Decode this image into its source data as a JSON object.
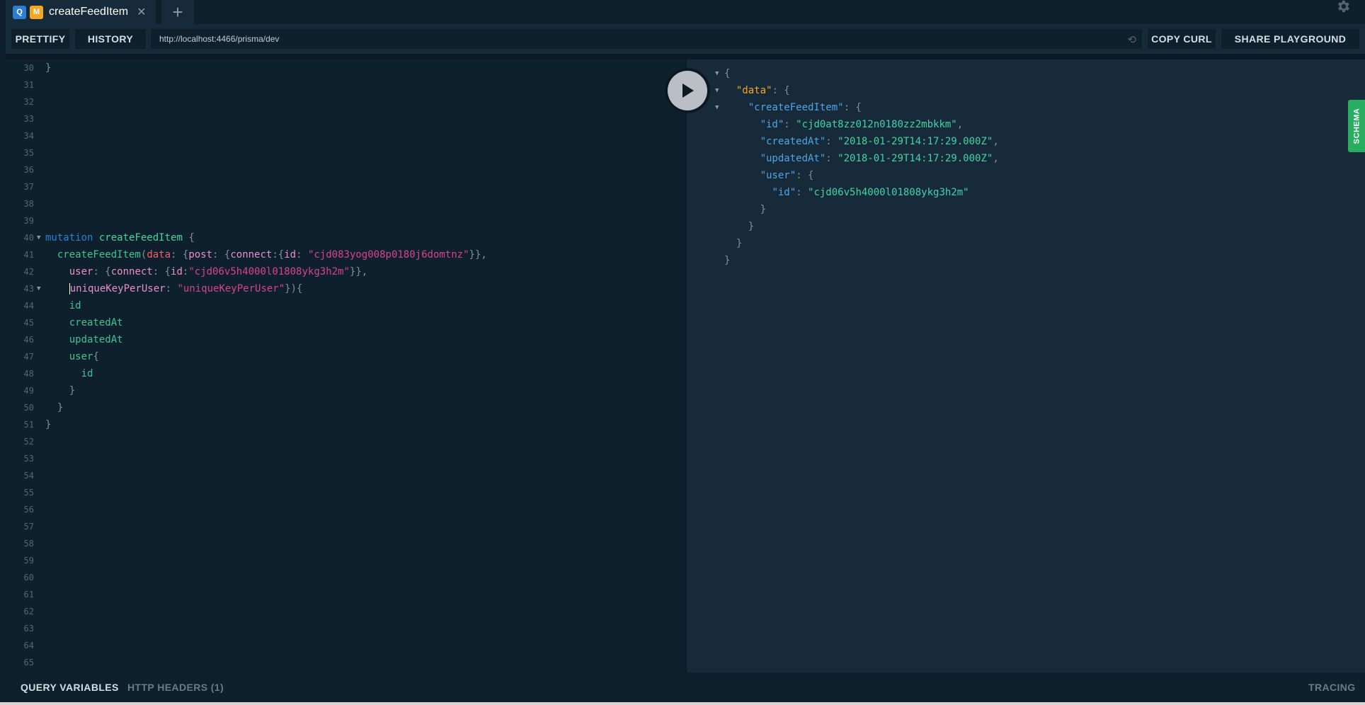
{
  "tabs": [
    {
      "query_badge": "Q",
      "mutation_badge": "M",
      "title": "createFeedItem",
      "close": "✕"
    }
  ],
  "add_tab": "+",
  "toolbar": {
    "prettify": "PRETTIFY",
    "history": "HISTORY",
    "url": "http://localhost:4466/prisma/dev",
    "copy_curl": "COPY CURL",
    "share": "SHARE PLAYGROUND"
  },
  "editor": {
    "lines": [
      {
        "n": "30",
        "fold": false,
        "tokens": [
          {
            "c": "t-p",
            "t": "}"
          }
        ]
      },
      {
        "n": "31",
        "fold": false,
        "tokens": []
      },
      {
        "n": "32",
        "fold": false,
        "tokens": []
      },
      {
        "n": "33",
        "fold": false,
        "tokens": []
      },
      {
        "n": "34",
        "fold": false,
        "tokens": []
      },
      {
        "n": "35",
        "fold": false,
        "tokens": []
      },
      {
        "n": "36",
        "fold": false,
        "tokens": []
      },
      {
        "n": "37",
        "fold": false,
        "tokens": []
      },
      {
        "n": "38",
        "fold": false,
        "tokens": []
      },
      {
        "n": "39",
        "fold": false,
        "tokens": []
      },
      {
        "n": "40",
        "fold": true,
        "tokens": [
          {
            "c": "t-kw",
            "t": "mutation"
          },
          {
            "c": "t-p",
            "t": " "
          },
          {
            "c": "t-def",
            "t": "createFeedItem"
          },
          {
            "c": "t-p",
            "t": " {"
          }
        ]
      },
      {
        "n": "41",
        "fold": false,
        "tokens": [
          {
            "c": "t-p",
            "t": "  "
          },
          {
            "c": "t-field",
            "t": "createFeedItem"
          },
          {
            "c": "t-p",
            "t": "("
          },
          {
            "c": "t-argd",
            "t": "data"
          },
          {
            "c": "t-p",
            "t": ": {"
          },
          {
            "c": "t-arg",
            "t": "post"
          },
          {
            "c": "t-p",
            "t": ": {"
          },
          {
            "c": "t-arg",
            "t": "connect"
          },
          {
            "c": "t-p",
            "t": ":{"
          },
          {
            "c": "t-arg",
            "t": "id"
          },
          {
            "c": "t-p",
            "t": ": "
          },
          {
            "c": "t-str",
            "t": "\"cjd083yog008p0180j6domtnz\""
          },
          {
            "c": "t-p",
            "t": "}},"
          }
        ]
      },
      {
        "n": "42",
        "fold": false,
        "tokens": [
          {
            "c": "t-p",
            "t": "    "
          },
          {
            "c": "t-arg",
            "t": "user"
          },
          {
            "c": "t-p",
            "t": ": {"
          },
          {
            "c": "t-arg",
            "t": "connect"
          },
          {
            "c": "t-p",
            "t": ": {"
          },
          {
            "c": "t-arg",
            "t": "id"
          },
          {
            "c": "t-p",
            "t": ":"
          },
          {
            "c": "t-str",
            "t": "\"cjd06v5h4000l01808ykg3h2m\""
          },
          {
            "c": "t-p",
            "t": "}},"
          }
        ]
      },
      {
        "n": "43",
        "fold": true,
        "cursor": true,
        "tokens": [
          {
            "c": "t-p",
            "t": "    "
          },
          {
            "c": "t-arg",
            "t": "uniqueKeyPerUser"
          },
          {
            "c": "t-p",
            "t": ": "
          },
          {
            "c": "t-str",
            "t": "\"uniqueKeyPerUser\""
          },
          {
            "c": "t-p",
            "t": "}){"
          }
        ]
      },
      {
        "n": "44",
        "fold": false,
        "tokens": [
          {
            "c": "t-p",
            "t": "    "
          },
          {
            "c": "t-field",
            "t": "id"
          }
        ]
      },
      {
        "n": "45",
        "fold": false,
        "tokens": [
          {
            "c": "t-p",
            "t": "    "
          },
          {
            "c": "t-field",
            "t": "createdAt"
          }
        ]
      },
      {
        "n": "46",
        "fold": false,
        "tokens": [
          {
            "c": "t-p",
            "t": "    "
          },
          {
            "c": "t-field",
            "t": "updatedAt"
          }
        ]
      },
      {
        "n": "47",
        "fold": false,
        "tokens": [
          {
            "c": "t-p",
            "t": "    "
          },
          {
            "c": "t-field",
            "t": "user"
          },
          {
            "c": "t-p",
            "t": "{"
          }
        ]
      },
      {
        "n": "48",
        "fold": false,
        "tokens": [
          {
            "c": "t-p",
            "t": "      "
          },
          {
            "c": "t-field",
            "t": "id"
          }
        ]
      },
      {
        "n": "49",
        "fold": false,
        "tokens": [
          {
            "c": "t-p",
            "t": "    }"
          }
        ]
      },
      {
        "n": "50",
        "fold": false,
        "tokens": [
          {
            "c": "t-p",
            "t": "  }"
          }
        ]
      },
      {
        "n": "51",
        "fold": false,
        "tokens": [
          {
            "c": "t-p",
            "t": "}"
          }
        ]
      },
      {
        "n": "52",
        "fold": false,
        "tokens": []
      },
      {
        "n": "53",
        "fold": false,
        "tokens": []
      },
      {
        "n": "54",
        "fold": false,
        "tokens": []
      },
      {
        "n": "55",
        "fold": false,
        "tokens": []
      },
      {
        "n": "56",
        "fold": false,
        "tokens": []
      },
      {
        "n": "57",
        "fold": false,
        "tokens": []
      },
      {
        "n": "58",
        "fold": false,
        "tokens": []
      },
      {
        "n": "59",
        "fold": false,
        "tokens": []
      },
      {
        "n": "60",
        "fold": false,
        "tokens": []
      },
      {
        "n": "61",
        "fold": false,
        "tokens": []
      },
      {
        "n": "62",
        "fold": false,
        "tokens": []
      },
      {
        "n": "63",
        "fold": false,
        "tokens": []
      },
      {
        "n": "64",
        "fold": false,
        "tokens": []
      },
      {
        "n": "65",
        "fold": false,
        "tokens": []
      }
    ]
  },
  "result": {
    "lines": [
      {
        "fold": true,
        "tokens": [
          {
            "c": "j-p",
            "t": "{"
          }
        ]
      },
      {
        "fold": true,
        "tokens": [
          {
            "c": "j-p",
            "t": "  "
          },
          {
            "c": "j-key-data",
            "t": "\"data\""
          },
          {
            "c": "j-p",
            "t": ": {"
          }
        ]
      },
      {
        "fold": true,
        "tokens": [
          {
            "c": "j-p",
            "t": "    "
          },
          {
            "c": "j-key",
            "t": "\"createFeedItem\""
          },
          {
            "c": "j-p",
            "t": ": {"
          }
        ]
      },
      {
        "fold": false,
        "tokens": [
          {
            "c": "j-p",
            "t": "      "
          },
          {
            "c": "j-key",
            "t": "\"id\""
          },
          {
            "c": "j-p",
            "t": ": "
          },
          {
            "c": "j-str",
            "t": "\"cjd0at8zz012n0180zz2mbkkm\""
          },
          {
            "c": "j-p",
            "t": ","
          }
        ]
      },
      {
        "fold": false,
        "tokens": [
          {
            "c": "j-p",
            "t": "      "
          },
          {
            "c": "j-key",
            "t": "\"createdAt\""
          },
          {
            "c": "j-p",
            "t": ": "
          },
          {
            "c": "j-str",
            "t": "\"2018-01-29T14:17:29.000Z\""
          },
          {
            "c": "j-p",
            "t": ","
          }
        ]
      },
      {
        "fold": false,
        "tokens": [
          {
            "c": "j-p",
            "t": "      "
          },
          {
            "c": "j-key",
            "t": "\"updatedAt\""
          },
          {
            "c": "j-p",
            "t": ": "
          },
          {
            "c": "j-str",
            "t": "\"2018-01-29T14:17:29.000Z\""
          },
          {
            "c": "j-p",
            "t": ","
          }
        ]
      },
      {
        "fold": false,
        "tokens": [
          {
            "c": "j-p",
            "t": "      "
          },
          {
            "c": "j-key",
            "t": "\"user\""
          },
          {
            "c": "j-p",
            "t": ": {"
          }
        ]
      },
      {
        "fold": false,
        "tokens": [
          {
            "c": "j-p",
            "t": "        "
          },
          {
            "c": "j-key",
            "t": "\"id\""
          },
          {
            "c": "j-p",
            "t": ": "
          },
          {
            "c": "j-str",
            "t": "\"cjd06v5h4000l01808ykg3h2m\""
          }
        ]
      },
      {
        "fold": false,
        "tokens": [
          {
            "c": "j-p",
            "t": "      }"
          }
        ]
      },
      {
        "fold": false,
        "tokens": [
          {
            "c": "j-p",
            "t": "    }"
          }
        ]
      },
      {
        "fold": false,
        "tokens": [
          {
            "c": "j-p",
            "t": "  }"
          }
        ]
      },
      {
        "fold": false,
        "tokens": [
          {
            "c": "j-p",
            "t": "}"
          }
        ]
      }
    ]
  },
  "schema_label": "SCHEMA",
  "bottom": {
    "query_variables": "QUERY VARIABLES",
    "http_headers": "HTTP HEADERS (1)",
    "tracing": "TRACING"
  },
  "icons": {
    "gear": "gear-icon",
    "play": "play-icon",
    "reload": "reload-icon"
  },
  "colors": {
    "accent_green": "#27ae60",
    "query_badge": "#2a7ed3",
    "mutation_badge": "#f5a623"
  }
}
